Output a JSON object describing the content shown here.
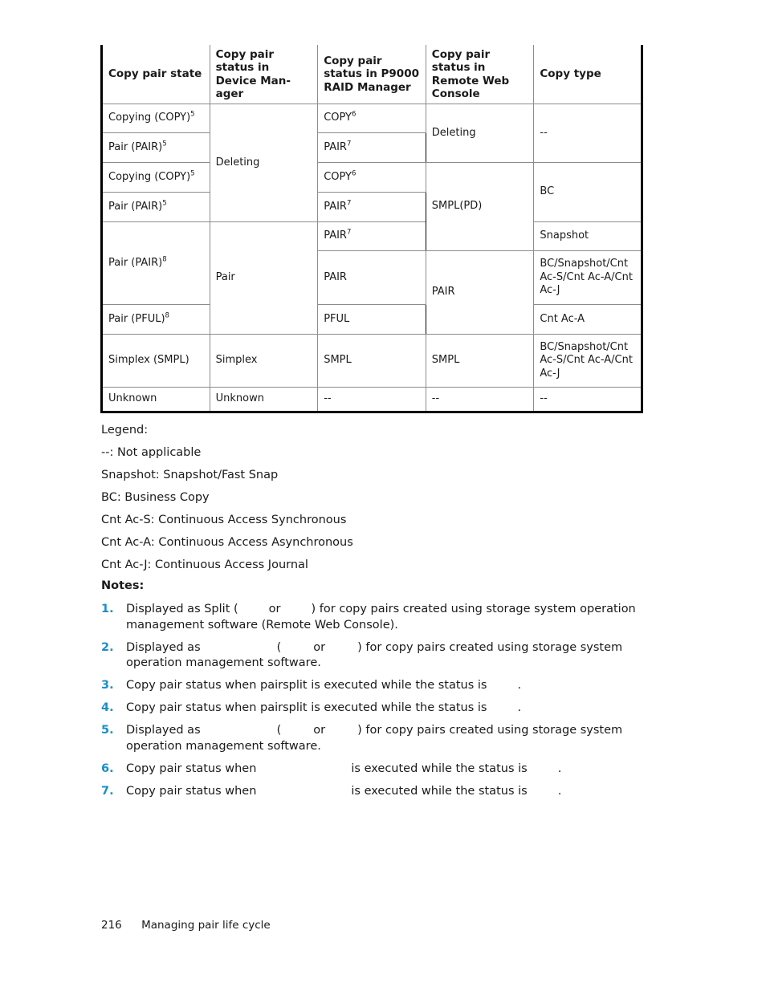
{
  "table": {
    "headers": [
      "Copy pair state",
      "Copy pair status in Device Man-ager",
      "Copy pair status in P9000 RAID Manager",
      "Copy pair status in Remote Web Console",
      "Copy type"
    ],
    "rows": [
      {
        "state": "Copying (COPY)",
        "state_sup": "5",
        "dm": "Deleting",
        "raid": "COPY",
        "raid_sup": "6",
        "rwc": "Deleting",
        "type": "--"
      },
      {
        "state": "Pair (PAIR)",
        "state_sup": "5",
        "raid": "PAIR",
        "raid_sup": "7"
      },
      {
        "state": "Copying (COPY)",
        "state_sup": "5",
        "raid": "COPY",
        "raid_sup": "6",
        "rwc": "SMPL(PD)",
        "type": "BC"
      },
      {
        "state": "Pair (PAIR)",
        "state_sup": "5",
        "raid": "PAIR",
        "raid_sup": "7"
      },
      {
        "state": "Pair (PAIR)",
        "state_sup": "8",
        "dm": "Pair",
        "raid": "PAIR",
        "raid_sup": "7",
        "type": "Snapshot"
      },
      {
        "raid": "PAIR",
        "rwc": "PAIR",
        "type": "BC/Snapshot/Cnt Ac-S/Cnt Ac-A/Cnt Ac-J"
      },
      {
        "state": "Pair (PFUL)",
        "state_sup": "8",
        "raid": "PFUL",
        "type": "Cnt Ac-A"
      },
      {
        "state": "Simplex (SMPL)",
        "dm": "Simplex",
        "raid": "SMPL",
        "rwc": "SMPL",
        "type": "BC/Snapshot/Cnt Ac-S/Cnt Ac-A/Cnt Ac-J"
      },
      {
        "state": "Unknown",
        "dm": "Unknown",
        "raid": "--",
        "rwc": "--",
        "type": "--"
      }
    ]
  },
  "legend": {
    "title": "Legend:",
    "items": [
      "--: Not applicable",
      "Snapshot: Snapshot/Fast Snap",
      "BC: Business Copy",
      "Cnt Ac-S: Continuous Access Synchronous",
      "Cnt Ac-A: Continuous Access Asynchronous",
      "Cnt Ac-J: Continuous Access Journal"
    ]
  },
  "notes": {
    "title": "Notes:",
    "items": [
      {
        "num": "1.",
        "a": "Displayed as Split (",
        "b": "or",
        "c": ") for copy pairs created using storage system operation management software (Remote Web Console)."
      },
      {
        "num": "2.",
        "a": "Displayed as",
        "b": "(",
        "c": "or",
        "d": ") for copy pairs created using storage system operation management software."
      },
      {
        "num": "3.",
        "a": "Copy pair status when pairsplit is executed while the status is",
        "b": "."
      },
      {
        "num": "4.",
        "a": "Copy pair status when pairsplit is executed while the status is",
        "b": "."
      },
      {
        "num": "5.",
        "a": "Displayed as",
        "b": "(",
        "c": "or",
        "d": ") for copy pairs created using storage system operation management software."
      },
      {
        "num": "6.",
        "a": "Copy pair status when",
        "b": "is executed while the status is",
        "c": "."
      },
      {
        "num": "7.",
        "a": "Copy pair status when",
        "b": "is executed while the status is",
        "c": "."
      }
    ]
  },
  "footer": {
    "page_number": "216",
    "section": "Managing pair life cycle"
  },
  "colors": {
    "note_number": "#1a8fc9"
  }
}
